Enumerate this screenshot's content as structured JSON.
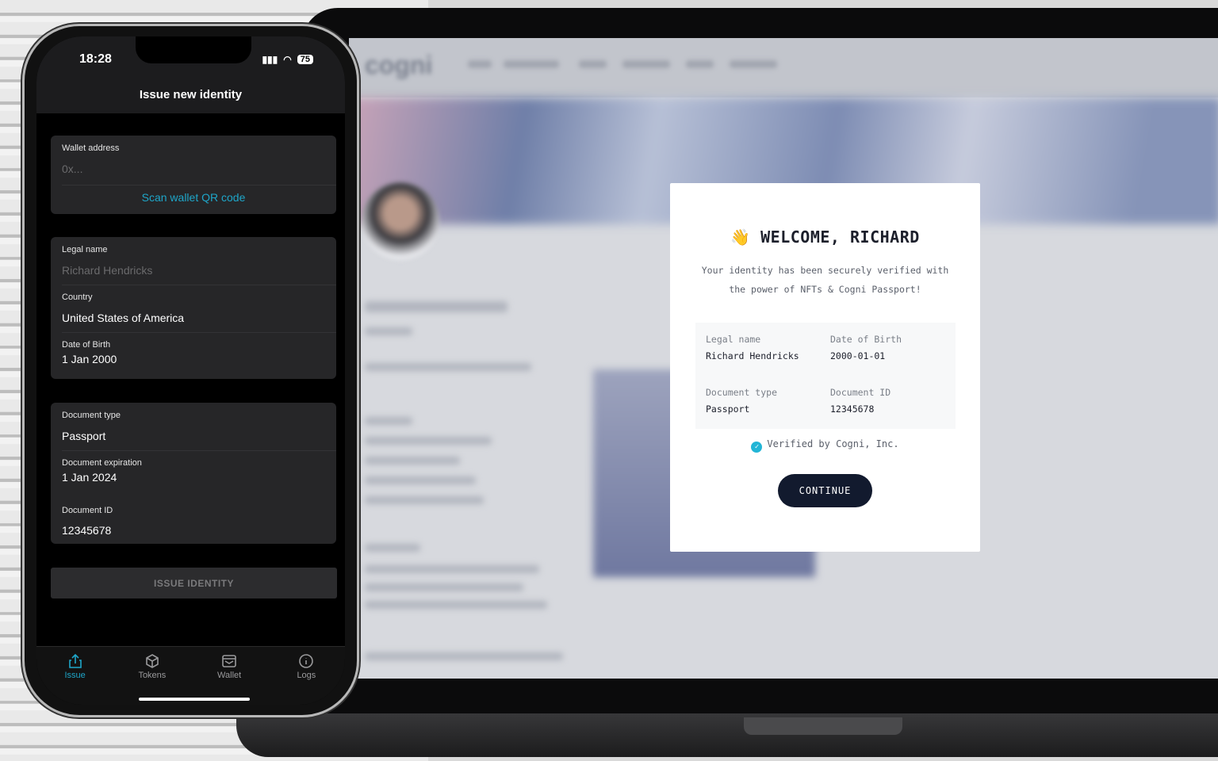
{
  "laptop": {
    "site_logo": "cogni",
    "modal": {
      "emoji": "👋",
      "title": "WELCOME, RICHARD",
      "subtitle": "Your identity has been securely verified with the power of NFTs & Cogni Passport!",
      "fields": [
        {
          "label": "Legal name",
          "value": "Richard Hendricks"
        },
        {
          "label": "Date of Birth",
          "value": "2000-01-01"
        },
        {
          "label": "Document type",
          "value": "Passport"
        },
        {
          "label": "Document ID",
          "value": "12345678"
        }
      ],
      "verified": "Verified by Cogni, Inc.",
      "continue_label": "CONTINUE"
    }
  },
  "phone": {
    "status": {
      "time": "18:28",
      "battery": "75"
    },
    "title": "Issue new identity",
    "wallet": {
      "label": "Wallet address",
      "placeholder": "0x...",
      "scan": "Scan wallet QR code"
    },
    "personal": {
      "legal_name_label": "Legal name",
      "legal_name_placeholder": "Richard Hendricks",
      "country_label": "Country",
      "country": "United States of America",
      "dob_label": "Date of Birth",
      "dob": "1 Jan 2000"
    },
    "document": {
      "type_label": "Document type",
      "type": "Passport",
      "expiration_label": "Document expiration",
      "expiration": "1 Jan 2024",
      "id_label": "Document ID",
      "id": "12345678"
    },
    "issue_button": "ISSUE IDENTITY",
    "tabs": [
      {
        "label": "Issue",
        "icon": "share-icon",
        "active": true
      },
      {
        "label": "Tokens",
        "icon": "cube-icon"
      },
      {
        "label": "Wallet",
        "icon": "wallet-icon"
      },
      {
        "label": "Logs",
        "icon": "info-icon"
      }
    ],
    "accent": "#1ea6c9"
  }
}
